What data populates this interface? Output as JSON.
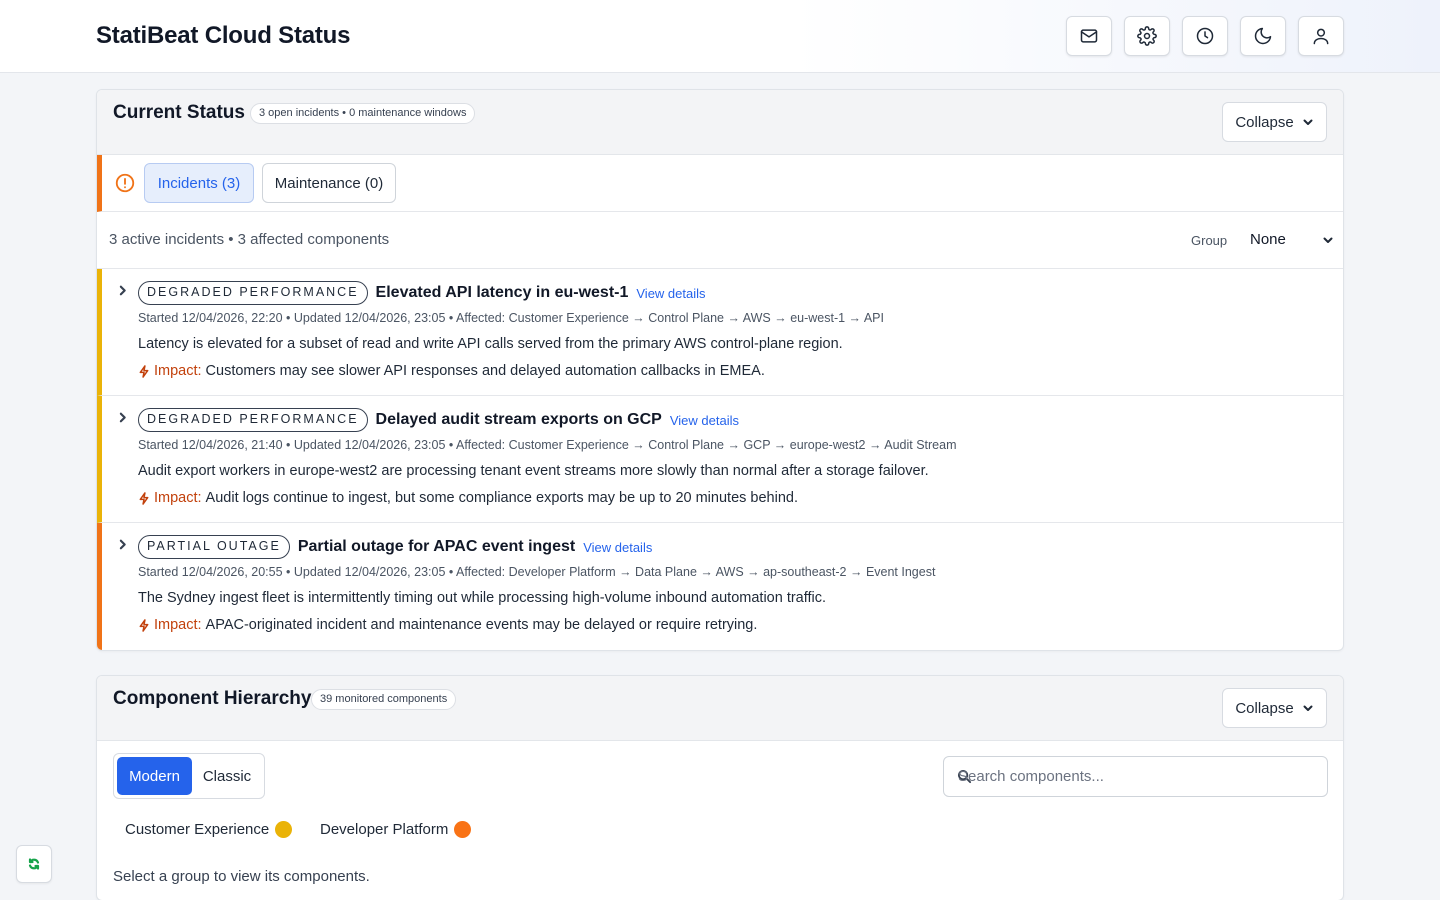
{
  "header": {
    "title": "StatiBeat Cloud Status",
    "actions": [
      {
        "icon": "mail-icon",
        "label": "Subscribe"
      },
      {
        "icon": "gear-icon",
        "label": "Settings"
      },
      {
        "icon": "clock-icon",
        "label": "History"
      },
      {
        "icon": "moon-icon",
        "label": "Dark mode"
      },
      {
        "icon": "user-icon",
        "label": "Account"
      }
    ]
  },
  "current_status": {
    "title": "Current Status",
    "pill": "3 open incidents • 0 maintenance windows",
    "collapse_label": "Collapse",
    "tabs": {
      "incidents": "Incidents (3)",
      "maintenance": "Maintenance (0)"
    },
    "summary": "3 active incidents • 3 affected components",
    "group_label": "Group",
    "group_value": "None",
    "incidents": [
      {
        "badge": "Degraded Performance",
        "title": "Elevated API latency in eu-west-1",
        "link": "View details",
        "meta": "Started 12/04/2026, 22:20 • Updated 12/04/2026, 23:05 • Affected: Customer Experience → Control Plane → AWS → eu-west-1 → API",
        "description": "Latency is elevated for a subset of read and write API calls served from the primary AWS control-plane region.",
        "impact_label": "Impact:",
        "impact": "Customers may see slower API responses and delayed automation callbacks in EMEA.",
        "color": "#eab308"
      },
      {
        "badge": "Degraded Performance",
        "title": "Delayed audit stream exports on GCP",
        "link": "View details",
        "meta": "Started 12/04/2026, 21:40 • Updated 12/04/2026, 23:05 • Affected: Customer Experience → Control Plane → GCP → europe-west2 → Audit Stream",
        "description": "Audit export workers in europe-west2 are processing tenant event streams more slowly than normal after a storage failover.",
        "impact_label": "Impact:",
        "impact": "Audit logs continue to ingest, but some compliance exports may be up to 20 minutes behind.",
        "color": "#eab308"
      },
      {
        "badge": "Partial Outage",
        "title": "Partial outage for APAC event ingest",
        "link": "View details",
        "meta": "Started 12/04/2026, 20:55 • Updated 12/04/2026, 23:05 • Affected: Developer Platform → Data Plane → AWS → ap-southeast-2 → Event Ingest",
        "description": "The Sydney ingest fleet is intermittently timing out while processing high-volume inbound automation traffic.",
        "impact_label": "Impact:",
        "impact": "APAC-originated incident and maintenance events may be delayed or require retrying.",
        "color": "#f07318"
      }
    ]
  },
  "components": {
    "title": "Component Hierarchy",
    "pill": "39 monitored components",
    "collapse_label": "Collapse",
    "view_modern": "Modern",
    "view_classic": "Classic",
    "search_placeholder": "Search components...",
    "groups": [
      {
        "name": "Customer Experience",
        "color": "#eab308"
      },
      {
        "name": "Developer Platform",
        "color": "#f97316"
      }
    ],
    "hint": "Select a group to view its components."
  },
  "colors": {
    "accent": "#2563eb",
    "degraded": "#eab308",
    "outage": "#f07318",
    "refresh": "#16a34a"
  }
}
